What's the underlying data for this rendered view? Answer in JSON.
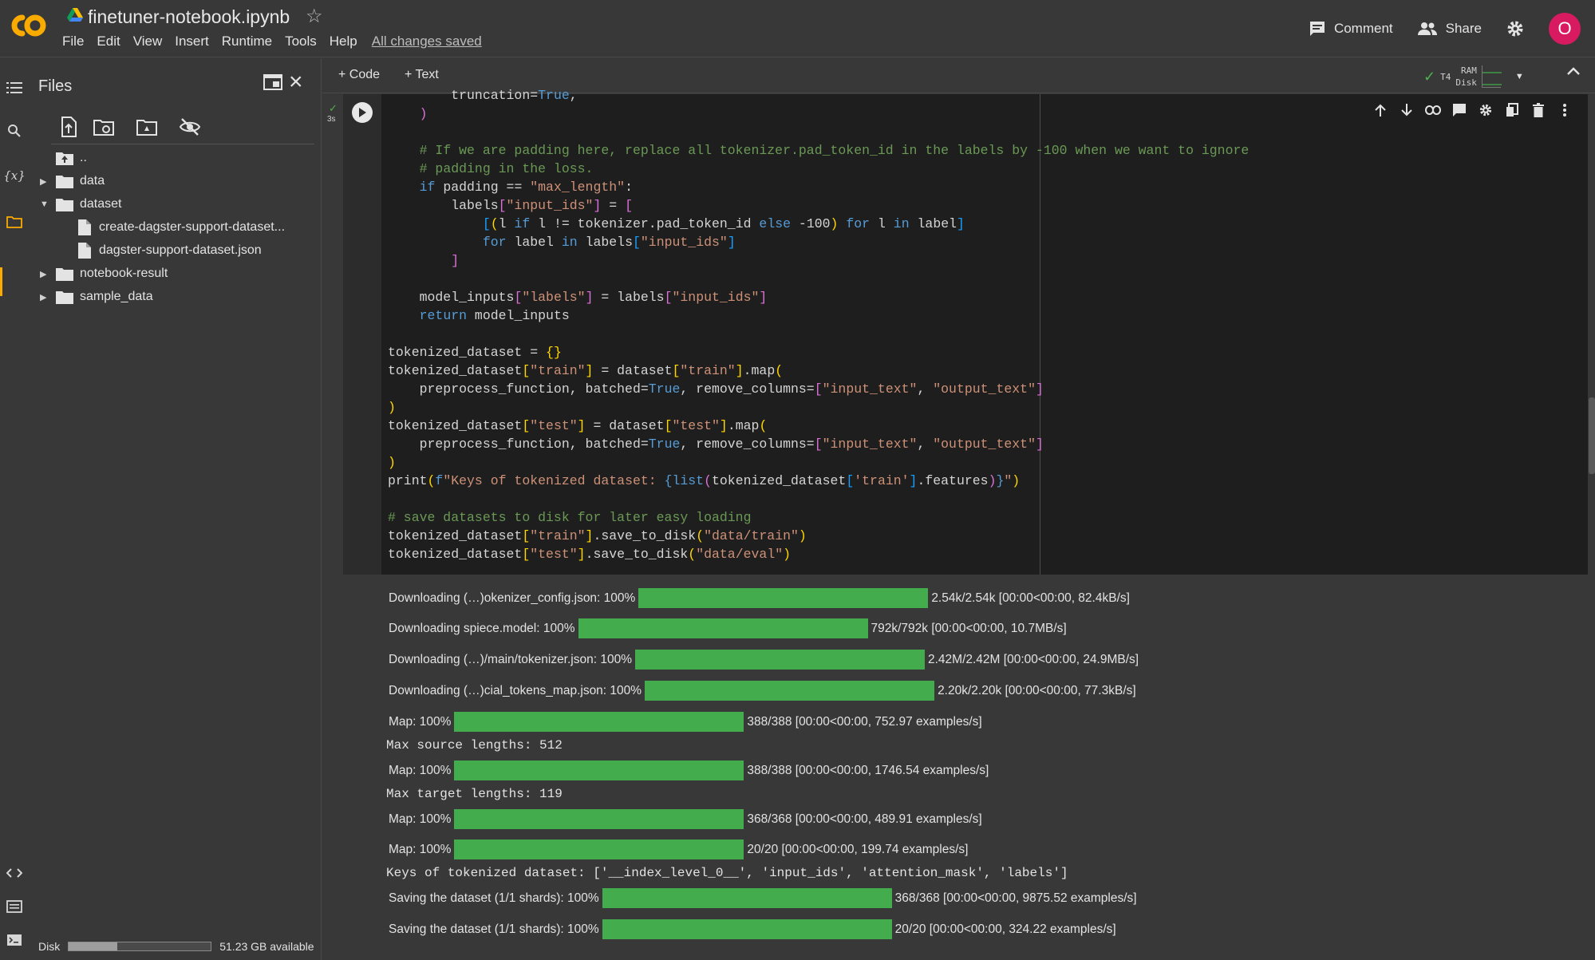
{
  "app": {
    "notebook_title": "finetuner-notebook.ipynb",
    "saved_status": "All changes saved",
    "menu": [
      "File",
      "Edit",
      "View",
      "Insert",
      "Runtime",
      "Tools",
      "Help"
    ],
    "comment_label": "Comment",
    "share_label": "Share",
    "avatar_letter": "O",
    "colors": {
      "accent": "#f9ab00",
      "progress": "#43ad4d",
      "avatar": "#d81b60"
    }
  },
  "files_panel": {
    "title": "Files",
    "tree": [
      {
        "name": "..",
        "type": "up"
      },
      {
        "name": "data",
        "type": "folder",
        "expanded": false
      },
      {
        "name": "dataset",
        "type": "folder",
        "expanded": true
      },
      {
        "name": "create-dagster-support-dataset...",
        "type": "file"
      },
      {
        "name": "dagster-support-dataset.json",
        "type": "file"
      },
      {
        "name": "notebook-result",
        "type": "folder",
        "expanded": false
      },
      {
        "name": "sample_data",
        "type": "folder",
        "expanded": false
      }
    ],
    "disk_label": "Disk",
    "disk_available": "51.23 GB available",
    "disk_used_fraction": 0.34
  },
  "toolbar": {
    "add_code": "+ Code",
    "add_text": "+ Text",
    "gpu": "T4",
    "ram_label": "RAM",
    "disk_label": "Disk"
  },
  "cell": {
    "exec_time": "3s"
  },
  "output": {
    "progress": [
      {
        "label": "Downloading (…)okenizer_config.json: 100%",
        "fraction": 1.0,
        "stats": "2.54k/2.54k [00:00<00:00, 82.4kB/s]"
      },
      {
        "label": "Downloading spiece.model: 100%",
        "fraction": 1.0,
        "stats": "792k/792k [00:00<00:00, 10.7MB/s]"
      },
      {
        "label": "Downloading (…)/main/tokenizer.json: 100%",
        "fraction": 1.0,
        "stats": "2.42M/2.42M [00:00<00:00, 24.9MB/s]"
      },
      {
        "label": "Downloading (…)cial_tokens_map.json: 100%",
        "fraction": 1.0,
        "stats": "2.20k/2.20k [00:00<00:00, 77.3kB/s]"
      },
      {
        "label": "Map: 100%",
        "fraction": 1.0,
        "stats": "388/388 [00:00<00:00, 752.97 examples/s]"
      },
      {
        "label": "Map: 100%",
        "fraction": 1.0,
        "stats": "388/388 [00:00<00:00, 1746.54 examples/s]"
      },
      {
        "label": "Map: 100%",
        "fraction": 1.0,
        "stats": "368/368 [00:00<00:00, 489.91 examples/s]"
      },
      {
        "label": "Map: 100%",
        "fraction": 1.0,
        "stats": "20/20 [00:00<00:00, 199.74 examples/s]"
      },
      {
        "label": "Saving the dataset (1/1 shards): 100%",
        "fraction": 1.0,
        "stats": "368/368 [00:00<00:00, 9875.52 examples/s]"
      },
      {
        "label": "Saving the dataset (1/1 shards): 100%",
        "fraction": 1.0,
        "stats": "20/20 [00:00<00:00, 324.22 examples/s]"
      }
    ],
    "text_lines": [
      "Max source lengths: 512",
      "Max target lengths: 119",
      "Keys of tokenized dataset: ['__index_level_0__', 'input_ids', 'attention_mask', 'labels']"
    ]
  }
}
